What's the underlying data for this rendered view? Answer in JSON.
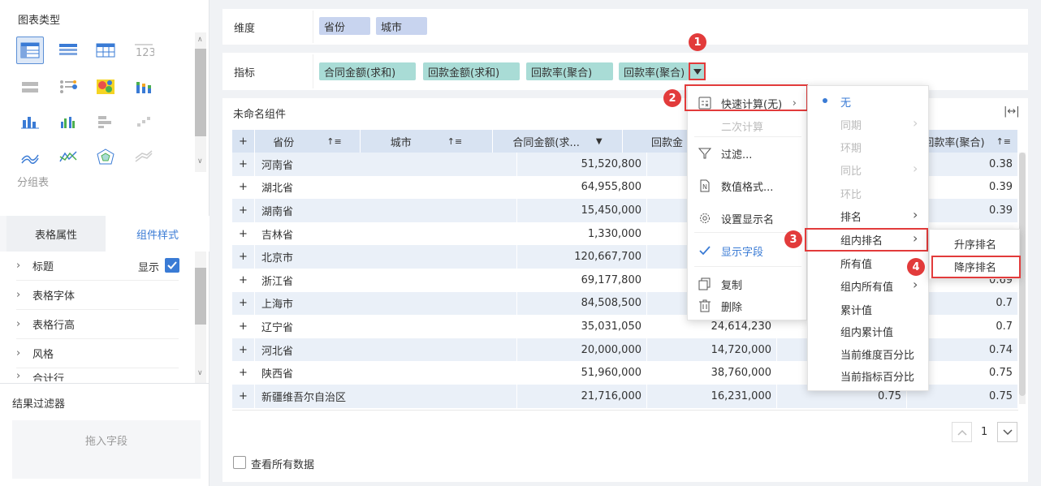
{
  "left_panel": {
    "chart_types_title": "图表类型",
    "group_table_label": "分组表",
    "tabs": {
      "table_props": "表格属性",
      "component_style": "组件样式"
    },
    "style_rows": [
      {
        "label": "标题",
        "extra": "显示"
      },
      {
        "label": "表格字体"
      },
      {
        "label": "表格行高"
      },
      {
        "label": "风格"
      },
      {
        "label": "合计行"
      }
    ],
    "result_filter_title": "结果过滤器",
    "drag_field_placeholder": "拖入字段"
  },
  "dimension": {
    "label": "维度",
    "pills": [
      "省份",
      "城市"
    ]
  },
  "indicator": {
    "label": "指标",
    "pills": [
      "合同金额(求和)",
      "回款金额(求和)",
      "回款率(聚合)",
      "回款率(聚合)"
    ]
  },
  "widget": {
    "title": "未命名组件",
    "columns": [
      "省份",
      "城市",
      "合同金额(求...",
      "回款金",
      "",
      "回款率(聚合)"
    ],
    "rows": [
      {
        "province": "河南省",
        "contract": "51,520,800",
        "payment": "",
        "rate1": "",
        "rate2": "0.38"
      },
      {
        "province": "湖北省",
        "contract": "64,955,800",
        "payment": "",
        "rate1": "",
        "rate2": "0.39"
      },
      {
        "province": "湖南省",
        "contract": "15,450,000",
        "payment": "",
        "rate1": "",
        "rate2": "0.39"
      },
      {
        "province": "吉林省",
        "contract": "1,330,000",
        "payment": "",
        "rate1": "",
        "rate2": ""
      },
      {
        "province": "北京市",
        "contract": "120,667,700",
        "payment": "",
        "rate1": "",
        "rate2": ""
      },
      {
        "province": "浙江省",
        "contract": "69,177,800",
        "payment": "",
        "rate1": "",
        "rate2": "0.69"
      },
      {
        "province": "上海市",
        "contract": "84,508,500",
        "payment": "",
        "rate1": "",
        "rate2": "0.7"
      },
      {
        "province": "辽宁省",
        "contract": "35,031,050",
        "payment": "24,614,230",
        "rate1": "",
        "rate2": "0.7"
      },
      {
        "province": "河北省",
        "contract": "20,000,000",
        "payment": "14,720,000",
        "rate1": "",
        "rate2": "0.74"
      },
      {
        "province": "陕西省",
        "contract": "51,960,000",
        "payment": "38,760,000",
        "rate1": "",
        "rate2": "0.75"
      },
      {
        "province": "新疆维吾尔自治区",
        "contract": "21,716,000",
        "payment": "16,231,000",
        "rate1": "0.75",
        "rate2": "0.75"
      }
    ],
    "page_number": "1",
    "view_all_label": "查看所有数据"
  },
  "menu1": {
    "items": [
      {
        "label": "快速计算(无)"
      },
      {
        "label": "二次计算"
      },
      {
        "label": "过滤..."
      },
      {
        "label": "数值格式..."
      },
      {
        "label": "设置显示名"
      },
      {
        "label": "显示字段"
      },
      {
        "label": "复制"
      },
      {
        "label": "删除"
      }
    ]
  },
  "menu2": {
    "items": [
      {
        "label": "无"
      },
      {
        "label": "同期"
      },
      {
        "label": "环期"
      },
      {
        "label": "同比"
      },
      {
        "label": "环比"
      },
      {
        "label": "排名"
      },
      {
        "label": "组内排名"
      },
      {
        "label": "所有值"
      },
      {
        "label": "组内所有值"
      },
      {
        "label": "累计值"
      },
      {
        "label": "组内累计值"
      },
      {
        "label": "当前维度百分比"
      },
      {
        "label": "当前指标百分比"
      }
    ]
  },
  "menu3": {
    "items": [
      {
        "label": "升序排名"
      },
      {
        "label": "降序排名"
      }
    ]
  },
  "steps": [
    "1",
    "2",
    "3",
    "4"
  ],
  "colors": {
    "accent": "#3a7bd5",
    "highlight": "#e23b3b",
    "dim_pill": "#c8d4ef",
    "ind_pill": "#a9dcd6"
  }
}
